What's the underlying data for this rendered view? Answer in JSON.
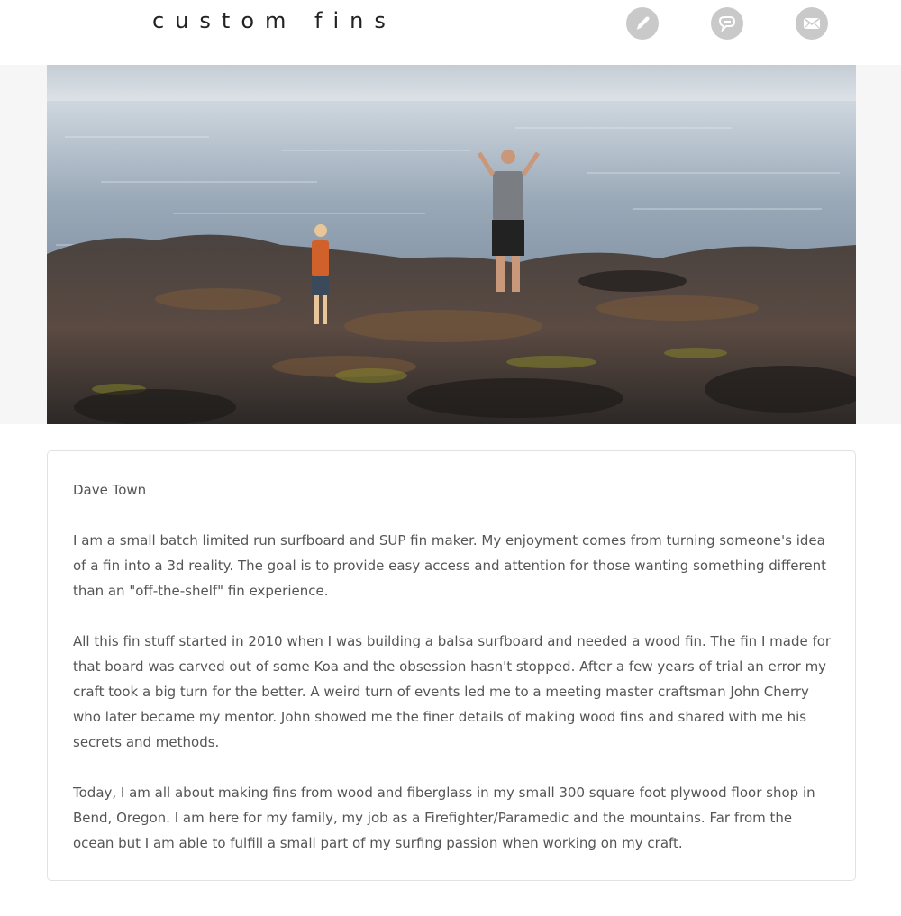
{
  "header": {
    "brand": "custom fins",
    "nav": [
      {
        "icon": "pencil-icon"
      },
      {
        "icon": "chat-bubble-icon"
      },
      {
        "icon": "envelope-icon"
      }
    ]
  },
  "colors": {
    "nav_button_bg": "#c9c9c9",
    "card_border": "#e2e2e2",
    "body_text": "#555555",
    "hero_band": "#f6f6f6"
  },
  "bio": {
    "name": "Dave Town",
    "paragraphs": [
      "I am a small batch limited run surfboard and SUP fin maker. My enjoyment comes from turning someone's idea of a fin into a 3d reality. The goal is to provide easy access and attention for those wanting something different than an \"off-the-shelf\" fin experience.",
      "All this fin stuff started in 2010 when I was building a balsa surfboard and needed a wood fin. The fin I made for that board was carved out of some Koa and the obsession hasn't stopped. After a few years of trial an error my craft took a big turn for the better. A weird turn of events led me to a meeting master craftsman John Cherry who later became my mentor. John showed me the finer details of making wood fins and shared with me his secrets and methods.",
      "Today, I am all about making fins from wood and fiberglass in my small 300 square foot plywood floor shop in Bend, Oregon. I am here for my family, my job as a Firefighter/Paramedic and the mountains. Far from the ocean but I am able to fulfill a small part of my surfing passion when working on my craft."
    ]
  }
}
